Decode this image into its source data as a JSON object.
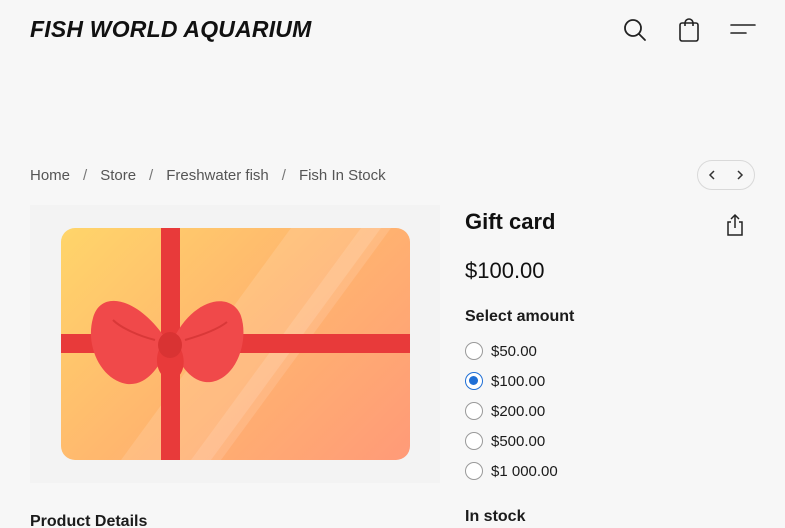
{
  "header": {
    "logo": "FISH WORLD AQUARIUM",
    "icons": {
      "search": "search-icon",
      "cart": "shopping-bag-icon",
      "menu": "menu-icon"
    }
  },
  "breadcrumb": {
    "items": [
      "Home",
      "Store",
      "Freshwater fish",
      "Fish In Stock"
    ],
    "separator": "/"
  },
  "pager": {
    "prev": "chevron-left-icon",
    "next": "chevron-right-icon"
  },
  "product": {
    "title": "Gift card",
    "price": "$100.00",
    "select_label": "Select amount",
    "options": [
      "$50.00",
      "$100.00",
      "$200.00",
      "$500.00",
      "$1 000.00"
    ],
    "selected_index": 1,
    "stock": "In stock",
    "details_heading": "Product Details",
    "share_icon": "share-icon",
    "image_icon": "gift-card-image"
  },
  "colors": {
    "accent": "#1f6fd6",
    "ribbon": "#e83a3a",
    "bow": "#f0494a",
    "card_gradient": [
      "#ffd56a",
      "#ffb86e",
      "#ff9a78"
    ],
    "background": "#f7f7f7"
  }
}
